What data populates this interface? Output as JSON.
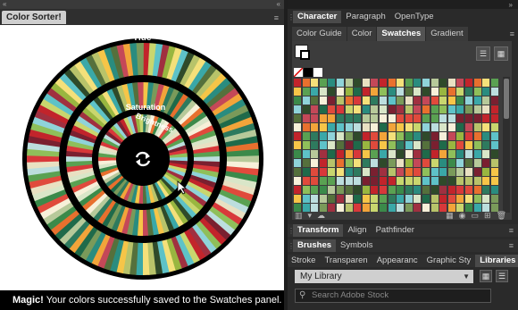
{
  "left_panel": {
    "title_tab": "Color Sorter!",
    "collapse_icon": "double-chevron-left-icon",
    "ring_labels": {
      "hue": "Hue",
      "saturation": "Saturation",
      "brightness": "Brightness"
    },
    "center_icon": "refresh-cycle-icon",
    "footer_bold": "Magic!",
    "footer_text": "Your colors successfully saved to the Swatches panel."
  },
  "right_panel": {
    "row1_tabs": [
      "Character",
      "Paragraph",
      "OpenType"
    ],
    "sub_tabs": [
      "Color Guide",
      "Color",
      "Swatches",
      "Gradient"
    ],
    "active_sub_tab": "Swatches",
    "transform_tabs": [
      "Transform",
      "Align",
      "Pathfinder"
    ],
    "brush_tabs": [
      "Brushes",
      "Symbols"
    ],
    "lower_tabs": [
      "Stroke",
      "Transparen",
      "Appearanc",
      "Graphic Sty",
      "Libraries"
    ],
    "library_select": "My Library",
    "search_placeholder": "Search Adobe Stock",
    "search_icon": "search-icon"
  },
  "colors": {
    "accent": "#cc2a2a",
    "panel_bg": "#2a2a2a",
    "footer_bg": "#000000"
  }
}
